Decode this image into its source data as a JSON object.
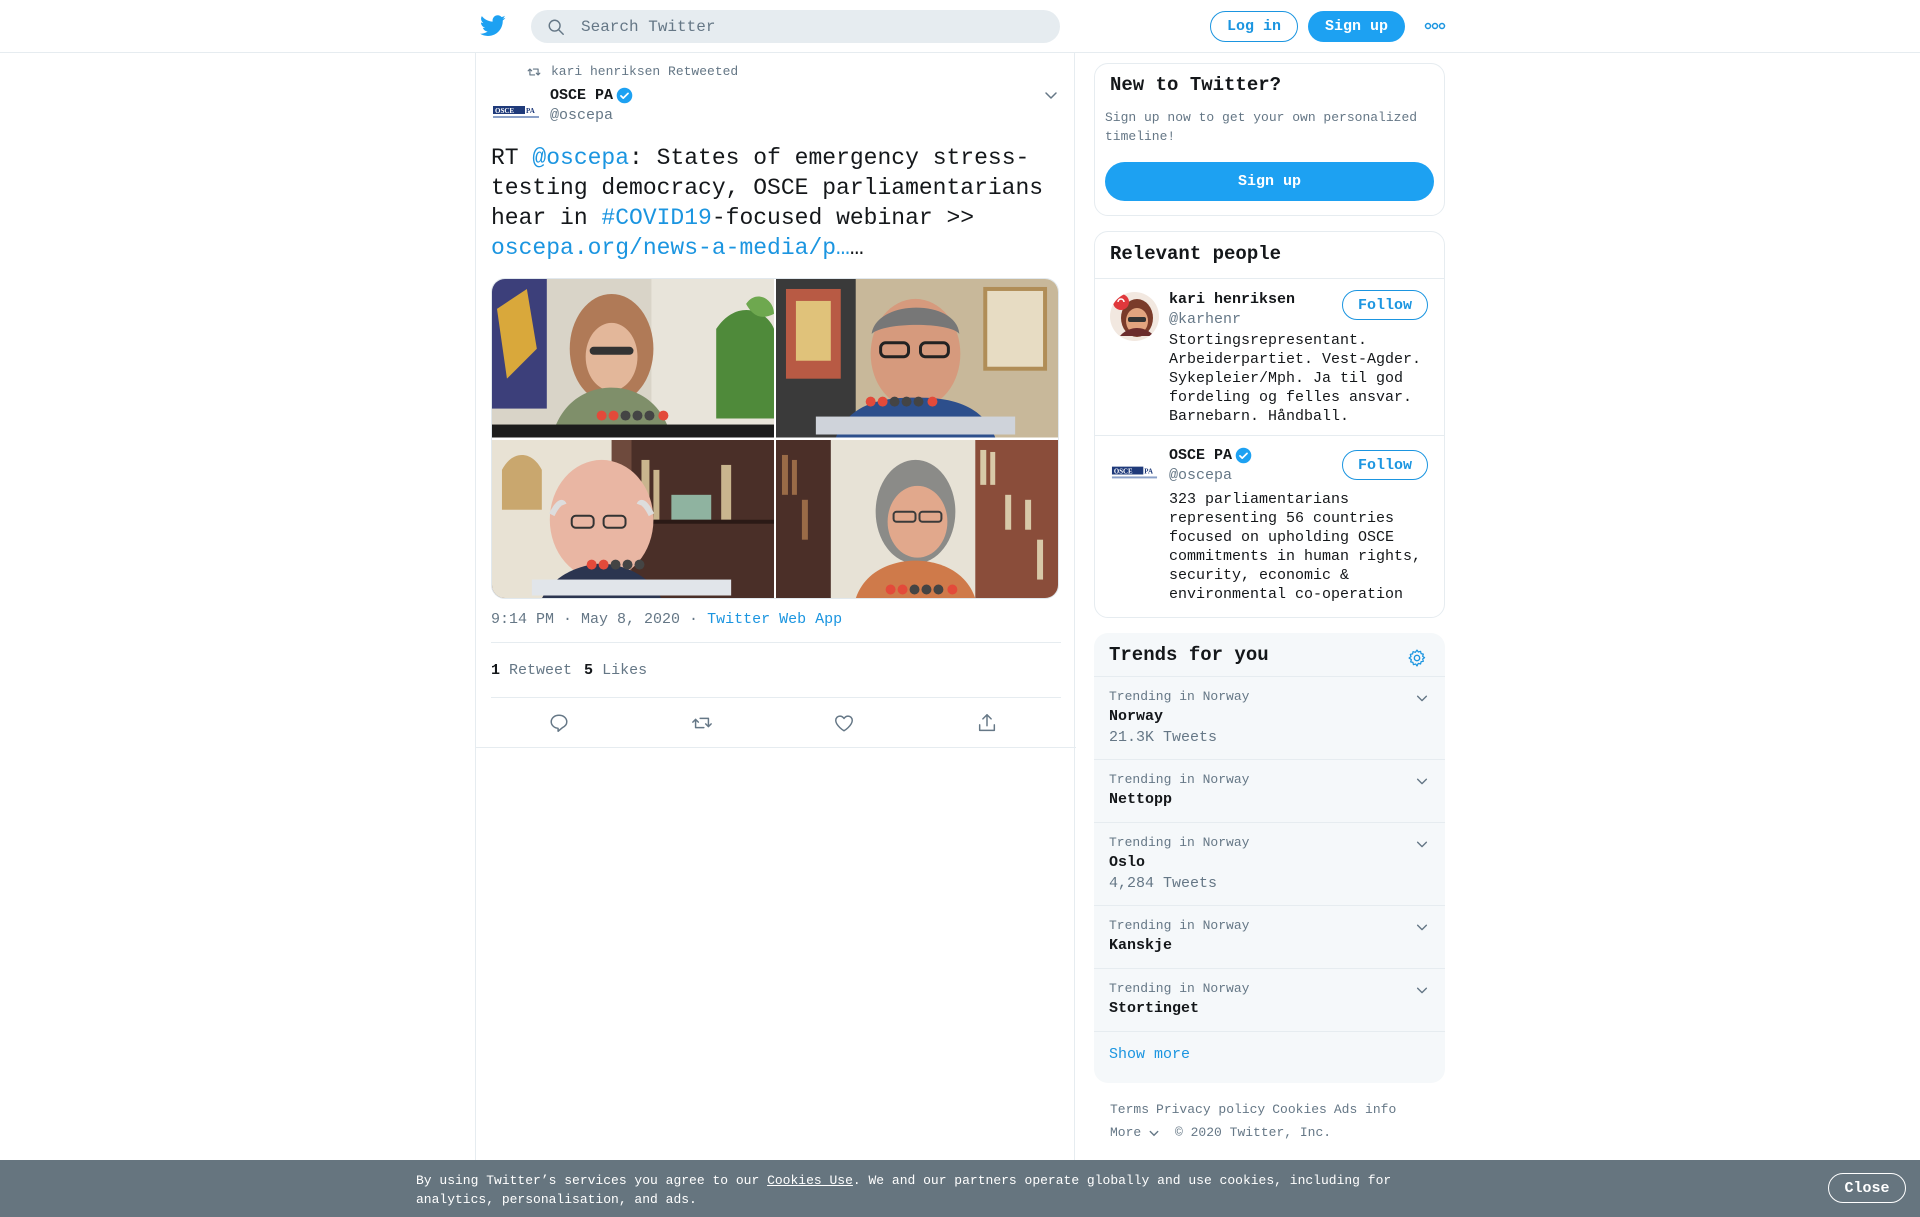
{
  "header": {
    "search_placeholder": "Search Twitter",
    "login_label": "Log in",
    "signup_label": "Sign up"
  },
  "tweet": {
    "retweeted_by": "kari henriksen Retweeted",
    "author_name": "OSCE PA",
    "author_handle": "@oscepa",
    "text_prefix": "RT ",
    "text_mention": "@oscepa",
    "text_mid": ": States of emergency stress-testing democracy, OSCE parliamentarians hear in ",
    "text_hashtag": "#COVID19",
    "text_after": "-focused webinar >> ",
    "text_link": "oscepa.org/news-a-media/p…",
    "text_ellipsis": "…",
    "timestamp": "9:14 PM · May 8, 2020",
    "separator": "·",
    "source": "Twitter Web App",
    "retweet_count": "1",
    "retweet_label": "Retweet",
    "like_count": "5",
    "like_label": "Likes"
  },
  "sidebar": {
    "new_title": "New to Twitter?",
    "new_desc": "Sign up now to get your own personalized timeline!",
    "new_signup": "Sign up",
    "people_title": "Relevant people",
    "people": [
      {
        "name": "kari henriksen",
        "handle": "@karhenr",
        "bio": "Stortingsrepresentant. Arbeiderpartiet. Vest-Agder. Sykepleier/Mph. Ja til god fordeling og felles ansvar. Barnebarn. Håndball.",
        "follow": "Follow"
      },
      {
        "name": "OSCE PA",
        "handle": "@oscepa",
        "bio": "323 parliamentarians representing 56 countries focused on upholding OSCE commitments in human rights, security, economic & environmental co-operation",
        "follow": "Follow"
      }
    ],
    "trends_title": "Trends for you",
    "trends": [
      {
        "context": "Trending in Norway",
        "name": "Norway",
        "count": "21.3K Tweets"
      },
      {
        "context": "Trending in Norway",
        "name": "Nettopp",
        "count": ""
      },
      {
        "context": "Trending in Norway",
        "name": "Oslo",
        "count": "4,284 Tweets"
      },
      {
        "context": "Trending in Norway",
        "name": "Kanskje",
        "count": ""
      },
      {
        "context": "Trending in Norway",
        "name": "Stortinget",
        "count": ""
      }
    ],
    "show_more": "Show more",
    "footer": {
      "terms": "Terms",
      "privacy": "Privacy policy",
      "cookies": "Cookies",
      "ads": "Ads info",
      "more": "More",
      "copyright": "© 2020 Twitter, Inc."
    }
  },
  "cookie_banner": {
    "text_before": "By using Twitter’s services you agree to our ",
    "link": "Cookies Use",
    "text_after": ". We and our partners operate globally and use cookies, including for analytics, personalisation, and ads.",
    "close": "Close"
  },
  "colors": {
    "accent": "#1da1f2",
    "link": "#1b95e0",
    "muted": "#657786",
    "banner": "#66757f"
  }
}
